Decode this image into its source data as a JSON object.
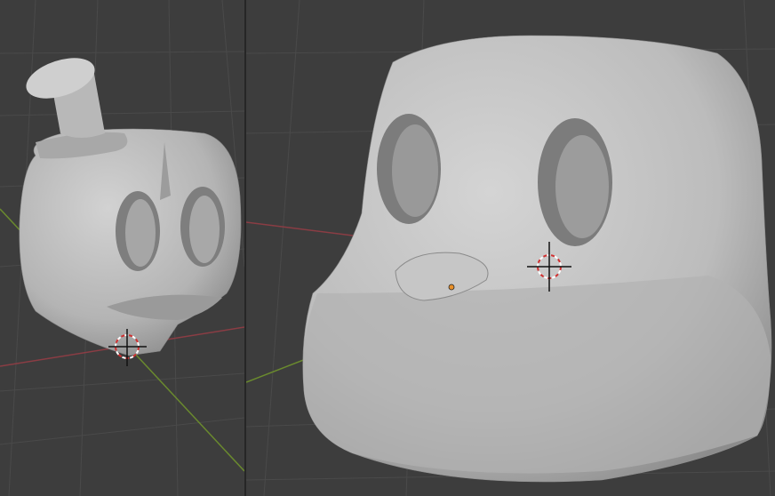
{
  "colors": {
    "viewport_bg": "#3d3d3d",
    "grid_line": "#4a4a4a",
    "x_axis": "#8a3d44",
    "y_axis": "#6a8a2e",
    "mesh_light": "#c8c8c8",
    "mesh_shadow": "#8a8a8a",
    "cursor_red": "#d03030",
    "origin_dot": "#e8902a"
  },
  "viewports": [
    {
      "name": "left",
      "object": "head-with-top-hat",
      "icons": [
        "3d-cursor-icon"
      ]
    },
    {
      "name": "right",
      "object": "head-closeup",
      "icons": [
        "3d-cursor-icon",
        "origin-point-icon"
      ]
    }
  ]
}
